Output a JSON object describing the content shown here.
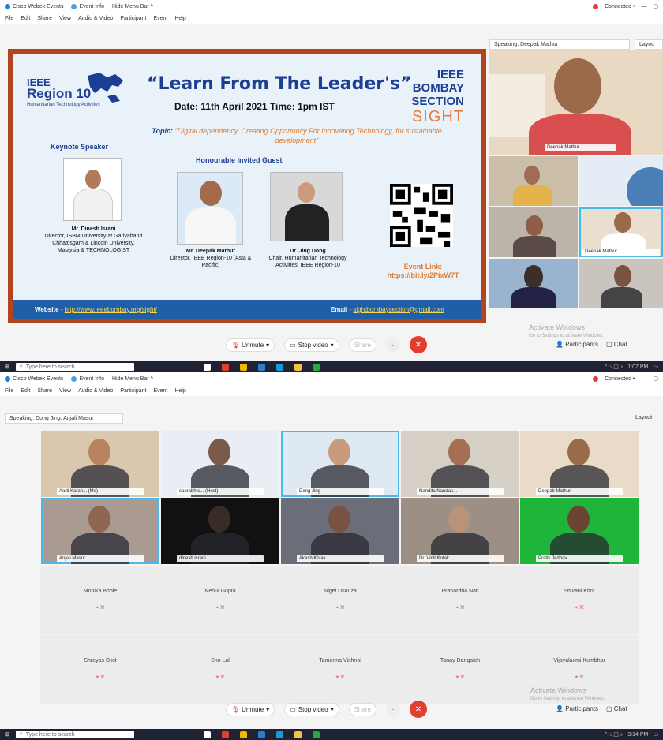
{
  "screen1": {
    "titlebar": {
      "app": "Cisco Webex Events",
      "tab": "Event Info",
      "hide_menu": "Hide Menu Bar ^",
      "status": "Connected •"
    },
    "menu": [
      "File",
      "Edit",
      "Share",
      "View",
      "Audio & Video",
      "Participant",
      "Event",
      "Help"
    ],
    "speaking": "Speaking: Deepak Mathur",
    "layout_label": "Layou",
    "slide": {
      "logo_l1": "IEEE",
      "logo_l2": "Region 10",
      "logo_l3": "Humanitarian Technology Activities",
      "title": "“Learn From The Leader's”",
      "date_label": "Date: 11th April 2021 Time: 1pm IST",
      "sight_top": "IEEE BOMBAY SECTION",
      "sight_bottom": "SIGHT",
      "topic_label": "Topic:",
      "topic": "\"Digital dependency, Creating Opportunity For Innovating Technology, for sustainable development\"",
      "keynote": "Keynote Speaker",
      "honour": "Honourable Invited Guest",
      "p1_name": "Mr. Dinesh Israni",
      "p1_desc": "Director, ISBM University at Gariyaband Chhattisgarh & Lincoln University, Malaysia & TECHNOLOGIST",
      "p2_name": "Mr. Deepak Mathur",
      "p2_desc": "Director, IEEE Region-10 (Asia & Pacific)",
      "p3_name": "Dr. Jing Dong",
      "p3_desc": "Chair, Humanitarian Technology Activities, IEEE Region-10",
      "event_link_label": "Event Link:",
      "event_link": "https://bit.ly/2PixW7T",
      "website_label": "Website",
      "website": "http://www.ieeebombay.org/sight/",
      "email_label": "Email",
      "email": "sightbombaysection@gmail.com"
    },
    "tiles": [
      "Deepak Mathur",
      "Deepak Mathur"
    ],
    "controls": {
      "unmute": "Unmute",
      "stop_video": "Stop video",
      "share": "Share",
      "participants": "Participants",
      "chat": "Chat"
    },
    "activate_title": "Activate Windows",
    "activate_sub": "Go to Settings to activate Windows.",
    "taskbar_search": "Type here to search",
    "clock_time": "1:07 PM"
  },
  "screen2": {
    "titlebar": {
      "app": "Cisco Webex Events",
      "tab": "Event Info",
      "hide_menu": "Hide Menu Bar ^",
      "status": "Connected •"
    },
    "menu": [
      "File",
      "Edit",
      "Share",
      "View",
      "Audio & Video",
      "Participant",
      "Event",
      "Help"
    ],
    "speaking": "Speaking: Dong Jing, Anjali Masur",
    "layout_label": "Layout",
    "video_row1": [
      "Aarti Karan... (Me)",
      "saurabh s... (Host)",
      "Dong Jing",
      "Nandita Nandak...",
      "Deepak Mathur"
    ],
    "video_row2": [
      "Anjali Masur",
      "dinesh israni",
      "Akash Kotak",
      "Dr. Vinit Kotak",
      "Pratik Jadhav"
    ],
    "blank_row1": [
      "Monika Bhole",
      "Nehul Gupta",
      "Nigel Dsouza",
      "Prahardha Nati",
      "Shivani Khot"
    ],
    "blank_row2": [
      "Shreyas Dixit",
      "Sno Lal",
      "Tamanna Vishnoi",
      "Tanay Dangaich",
      "Vijayalaxmi Kumbhar"
    ],
    "controls": {
      "unmute": "Unmute",
      "stop_video": "Stop video",
      "share": "Share",
      "participants": "Participants",
      "chat": "Chat"
    },
    "activate_title": "Activate Windows",
    "activate_sub": "Go to Settings to activate Windows.",
    "taskbar_search": "Type here to search",
    "clock_time": "3:14 PM"
  }
}
